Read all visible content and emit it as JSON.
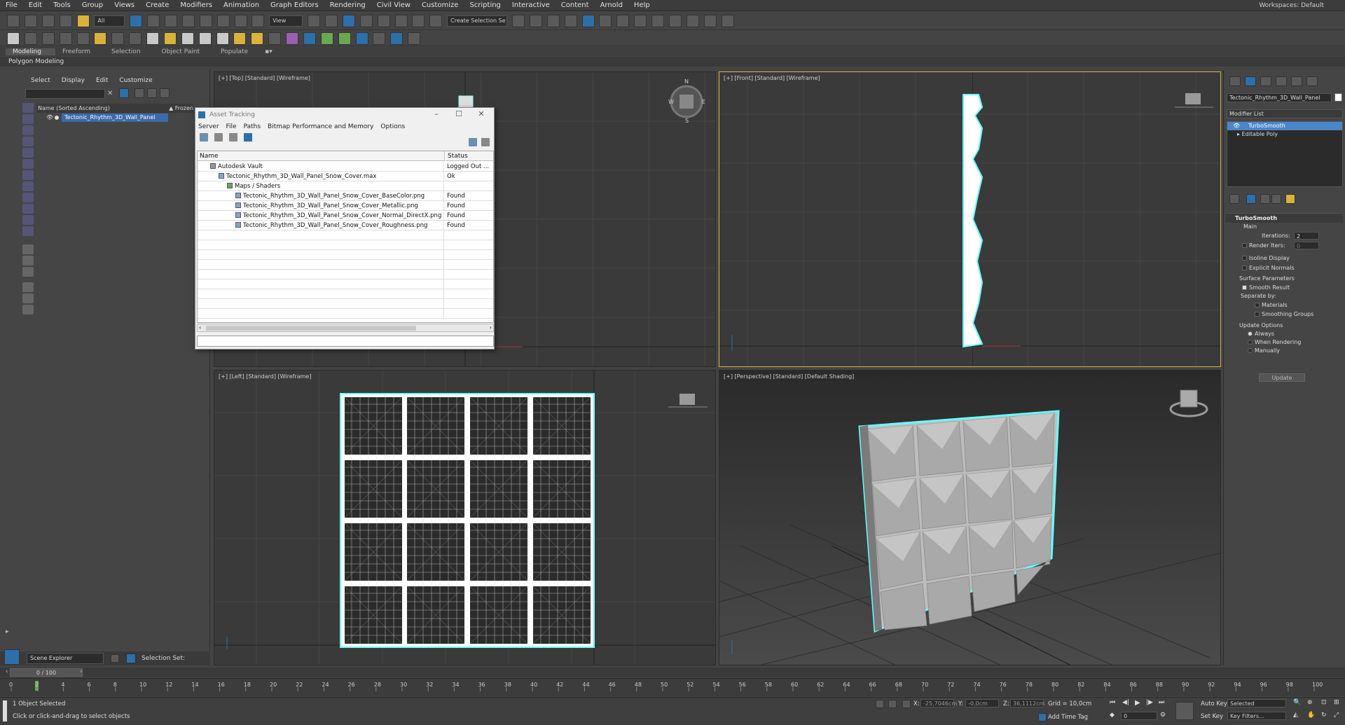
{
  "menu": {
    "items": [
      "File",
      "Edit",
      "Tools",
      "Group",
      "Views",
      "Create",
      "Modifiers",
      "Animation",
      "Graph Editors",
      "Rendering",
      "Civil View",
      "Customize",
      "Scripting",
      "Interactive",
      "Content",
      "Arnold",
      "Help"
    ],
    "workspaces_label": "Workspaces:",
    "workspace_value": "Default"
  },
  "toolbar": {
    "filter_value": "All",
    "coord_value": "View",
    "selection_set_value": "Create Selection Se"
  },
  "ribbon": {
    "tabs": [
      "Modeling",
      "Freeform",
      "Selection",
      "Object Paint",
      "Populate"
    ],
    "active_tab": "Modeling",
    "panel_label": "Polygon Modeling"
  },
  "scene_explorer": {
    "menus": [
      "Select",
      "Display",
      "Edit",
      "Customize"
    ],
    "col_name": "Name (Sorted Ascending)",
    "col_frozen": "▲ Frozen",
    "object": "Tectonic_Rhythm_3D_Wall_Panel",
    "explorer_name": "Scene Explorer",
    "selection_set_label": "Selection Set:"
  },
  "viewports": {
    "top": "[+] [Top] [Standard] [Wireframe]",
    "front": "[+] [Front] [Standard] [Wireframe]",
    "left": "[+] [Left] [Standard] [Wireframe]",
    "perspective": "[+] [Perspective] [Standard] [Default Shading]"
  },
  "asset_tracking": {
    "title": "Asset Tracking",
    "menus": [
      "Server",
      "File",
      "Paths",
      "Bitmap Performance and Memory",
      "Options"
    ],
    "col_name": "Name",
    "col_status": "Status",
    "rows": [
      {
        "name": "Autodesk Vault",
        "status": "Logged Out ...",
        "indent": 1
      },
      {
        "name": "Tectonic_Rhythm_3D_Wall_Panel_Snow_Cover.max",
        "status": "Ok",
        "indent": 2
      },
      {
        "name": "Maps / Shaders",
        "status": "",
        "indent": 3
      },
      {
        "name": "Tectonic_Rhythm_3D_Wall_Panel_Snow_Cover_BaseColor.png",
        "status": "Found",
        "indent": 4
      },
      {
        "name": "Tectonic_Rhythm_3D_Wall_Panel_Snow_Cover_Metallic.png",
        "status": "Found",
        "indent": 4
      },
      {
        "name": "Tectonic_Rhythm_3D_Wall_Panel_Snow_Cover_Normal_DirectX.png",
        "status": "Found",
        "indent": 4
      },
      {
        "name": "Tectonic_Rhythm_3D_Wall_Panel_Snow_Cover_Roughness.png",
        "status": "Found",
        "indent": 4
      }
    ]
  },
  "command_panel": {
    "object_name": "Tectonic_Rhythm_3D_Wall_Panel",
    "modifier_list": "Modifier List",
    "stack": [
      "TurboSmooth",
      "Editable Poly"
    ],
    "rollout_title": "TurboSmooth",
    "main_label": "Main",
    "iterations_label": "Iterations:",
    "iterations_value": "2",
    "render_iters_label": "Render Iters:",
    "render_iters_value": "0",
    "isoline_label": "Isoline Display",
    "explicit_normals_label": "Explicit Normals",
    "surface_params_label": "Surface Parameters",
    "smooth_result_label": "Smooth Result",
    "separate_by_label": "Separate by:",
    "materials_label": "Materials",
    "smoothing_groups_label": "Smoothing Groups",
    "update_options_label": "Update Options",
    "always_label": "Always",
    "when_rendering_label": "When Rendering",
    "manually_label": "Manually",
    "update_button": "Update"
  },
  "timeline": {
    "frame_counter": "0 / 100",
    "ticks": [
      0,
      2,
      4,
      6,
      8,
      10,
      12,
      14,
      16,
      18,
      20,
      22,
      24,
      26,
      28,
      30,
      32,
      34,
      36,
      38,
      40,
      42,
      44,
      46,
      48,
      50,
      52,
      54,
      56,
      58,
      60,
      62,
      64,
      66,
      68,
      70,
      72,
      74,
      76,
      78,
      80,
      82,
      84,
      86,
      88,
      90,
      92,
      94,
      96,
      98,
      100
    ]
  },
  "status": {
    "selected_text": "1 Object Selected",
    "prompt_text": "Click or click-and-drag to select objects",
    "x_label": "X:",
    "x_value": "-25,7046cm",
    "y_label": "Y:",
    "y_value": "-0,0cm",
    "z_label": "Z:",
    "z_value": "36,1112cm",
    "grid_text": "Grid = 10,0cm",
    "add_time_tag": "Add Time Tag",
    "auto_key": "Auto Key",
    "set_key": "Set Key",
    "selected_value": "Selected",
    "key_filters": "Key Filters...",
    "frame_value": "0"
  }
}
